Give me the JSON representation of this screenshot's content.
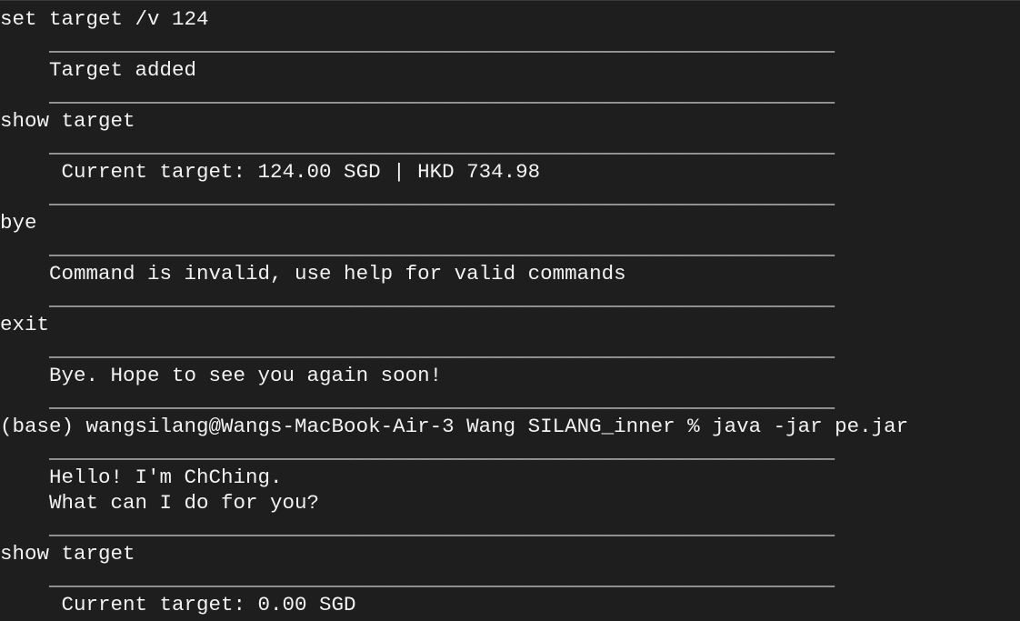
{
  "terminal": {
    "lines": [
      "set target /v 124",
      "    ________________________________________________________________",
      "    Target added",
      "    ________________________________________________________________",
      "show target",
      "    ________________________________________________________________",
      "     Current target: 124.00 SGD | HKD 734.98",
      "    ________________________________________________________________",
      "bye",
      "    ________________________________________________________________",
      "    Command is invalid, use help for valid commands",
      "    ________________________________________________________________",
      "exit",
      "    ________________________________________________________________",
      "    Bye. Hope to see you again soon!",
      "    ________________________________________________________________",
      "(base) wangsilang@Wangs-MacBook-Air-3 Wang SILANG_inner % java -jar pe.jar",
      "    ________________________________________________________________",
      "    Hello! I'm ChChing.",
      "    What can I do for you?",
      "    ________________________________________________________________",
      "show target",
      "    ________________________________________________________________",
      "     Current target: 0.00 SGD"
    ]
  }
}
